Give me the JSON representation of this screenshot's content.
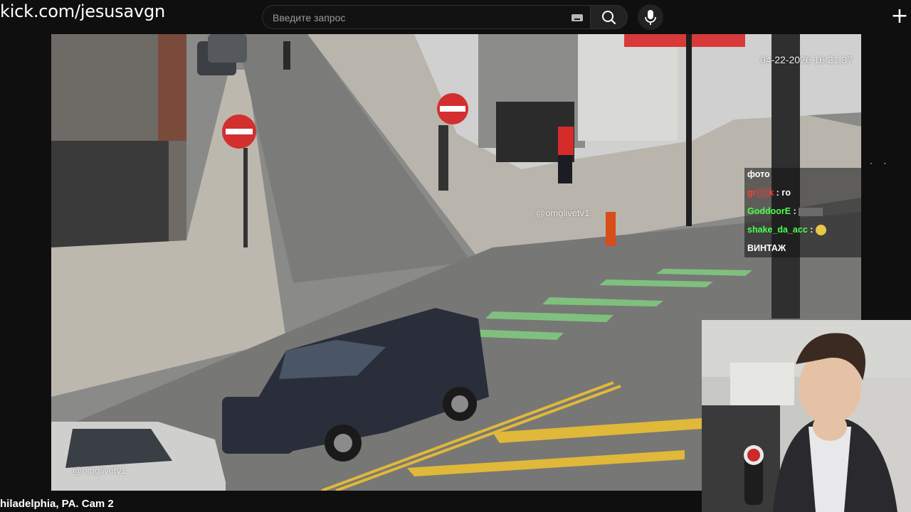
{
  "url_label": "kick.com/jesusavgn",
  "search": {
    "placeholder": "Введите запрос",
    "value": ""
  },
  "icons": {
    "search": "search-icon",
    "keyboard": "keyboard-icon",
    "mic": "microphone-icon",
    "create": "plus-icon"
  },
  "stream": {
    "timestamp": "04-22-2026 16:21:37",
    "watermark_top": "@omglivetv1",
    "watermark_bottom": "@omglivetv1",
    "caption": "hiladelphia, PA. Cam 2"
  },
  "chat": {
    "messages": [
      {
        "user": "",
        "text": "фото",
        "user_color": "#ffffff"
      },
      {
        "user": "gr▒▒k",
        "text": ": го",
        "user_color": "#ff3b3b"
      },
      {
        "user": "GoddoorE",
        "text": ":",
        "user_color": "#4cff4c"
      },
      {
        "user": "shake_da_acc",
        "text": ":",
        "user_color": "#4cff4c"
      },
      {
        "user": "",
        "text": "ВИНТАЖ",
        "user_color": "#ffffff"
      }
    ]
  },
  "edge_dots": "· ·",
  "colors": {
    "background": "#0f0f0f",
    "search_bg": "#121212",
    "search_border": "#303030",
    "button_bg": "#222222",
    "chat_green": "#4cff4c",
    "chat_red": "#ff3b3b"
  }
}
